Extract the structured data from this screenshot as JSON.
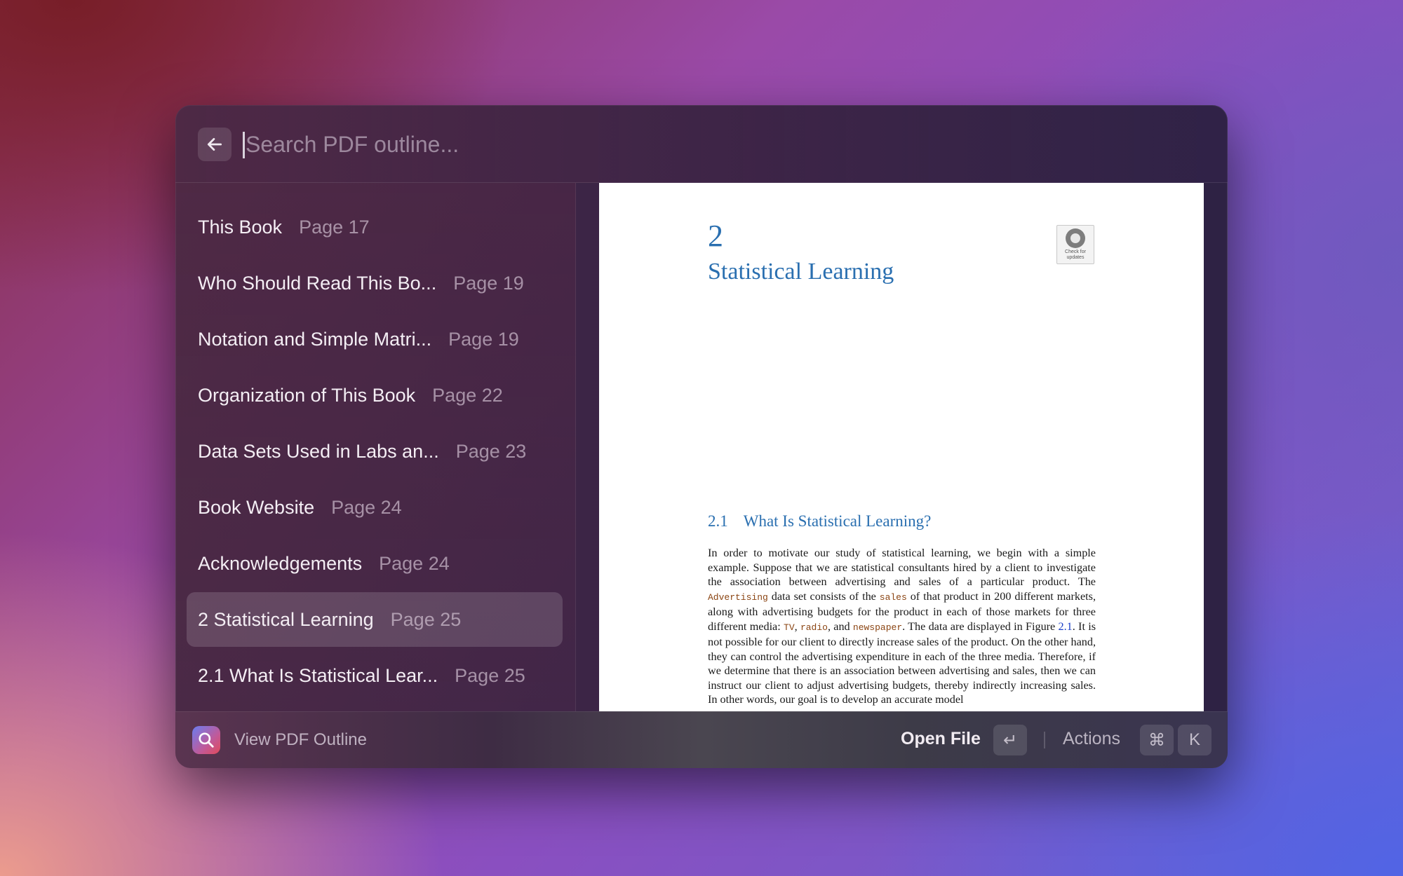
{
  "search": {
    "placeholder": "Search PDF outline..."
  },
  "outline": [
    {
      "title": "This Book",
      "page": "Page 17"
    },
    {
      "title": "Who Should Read This Bo...",
      "page": "Page 19"
    },
    {
      "title": "Notation and Simple Matri...",
      "page": "Page 19"
    },
    {
      "title": "Organization of This Book",
      "page": "Page 22"
    },
    {
      "title": "Data Sets Used in Labs an...",
      "page": "Page 23"
    },
    {
      "title": "Book Website",
      "page": "Page 24"
    },
    {
      "title": "Acknowledgements",
      "page": "Page 24"
    },
    {
      "title": "2 Statistical Learning",
      "page": "Page 25",
      "selected": true
    },
    {
      "title": "2.1 What Is Statistical Lear...",
      "page": "Page 25"
    }
  ],
  "preview": {
    "chapter_number": "2",
    "chapter_title": "Statistical Learning",
    "check_updates_label": "Check for updates",
    "section_number": "2.1",
    "section_title": "What Is Statistical Learning?",
    "body": [
      "In order to motivate our study of statistical learning, we begin with a simple example. Suppose that we are statistical consultants hired by a client to investigate the association between advertising and sales of a particular product. The ",
      "Advertising",
      " data set consists of the ",
      "sales",
      " of that product in 200 different markets, along with advertising budgets for the product in each of those markets for three different media: ",
      "TV",
      ", ",
      "radio",
      ", and ",
      "newspaper",
      ". The data are displayed in Figure ",
      "2.1",
      ". It is not possible for our client to directly increase sales of the product. On the other hand, they can control the advertising expenditure in each of the three media. Therefore, if we determine that there is an association between advertising and sales, then we can instruct our client to adjust advertising budgets, thereby indirectly increasing sales. In other words, our goal is to develop an accurate model"
    ]
  },
  "footer": {
    "title": "View PDF Outline",
    "primary_action": "Open File",
    "enter_key": "↵",
    "actions_label": "Actions",
    "cmd_key": "⌘",
    "k_key": "K"
  },
  "icons": {
    "back": "arrow-left-icon",
    "app": "magnifier-icon"
  }
}
